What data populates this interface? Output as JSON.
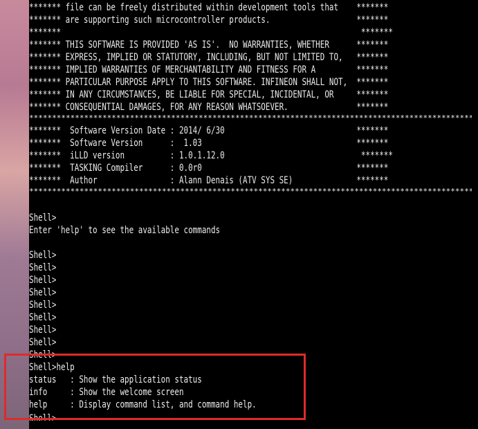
{
  "banner_lines": [
    "******* file can be freely distributed within development tools that    *******",
    "******* are supporting such microcontroller products.                   *******",
    "*******                                                                  *******",
    "******* THIS SOFTWARE IS PROVIDED 'AS IS'.  NO WARRANTIES, WHETHER      *******",
    "******* EXPRESS, IMPLIED OR STATUTORY, INCLUDING, BUT NOT LIMITED TO,   *******",
    "******* IMPLIED WARRANTIES OF MERCHANTABILITY AND FITNESS FOR A         *******",
    "******* PARTICULAR PURPOSE APPLY TO THIS SOFTWARE. INFINEON SHALL NOT,  *******",
    "******* IN ANY CIRCUMSTANCES, BE LIABLE FOR SPECIAL, INCIDENTAL, OR     *******",
    "******* CONSEQUENTIAL DAMAGES, FOR ANY REASON WHATSOEVER.               *******"
  ],
  "separator": "**************************************************************************************************************",
  "version_lines": [
    "*******  Software Version Date : 2014/ 6/30                             *******",
    "*******  Software Version      :  1.03                                  *******",
    "*******  iLLD version          : 1.0.1.12.0                              *******",
    "*******  TASKING Compiler      : 0.0r0                                  *******",
    "*******  Author                : Alann Denais (ATV SYS SE)              *******"
  ],
  "shell": {
    "prompt": "Shell>",
    "help_hint": "Enter 'help' to see the available commands",
    "empty_prompts": [
      "Shell>",
      "Shell>",
      "Shell>",
      "Shell>",
      "Shell>",
      "Shell>",
      "Shell>",
      "Shell>",
      "Shell>"
    ],
    "help_command": "Shell>help",
    "commands": [
      {
        "text": "status   : Show the application status"
      },
      {
        "text": "info     : Show the welcome screen"
      },
      {
        "text": "help     : Display command list, and command help."
      }
    ],
    "last_prompt": "Shell>"
  },
  "colors": {
    "terminal_bg": "#000000",
    "terminal_text": "#ececec",
    "highlight": "#e02a2a"
  }
}
